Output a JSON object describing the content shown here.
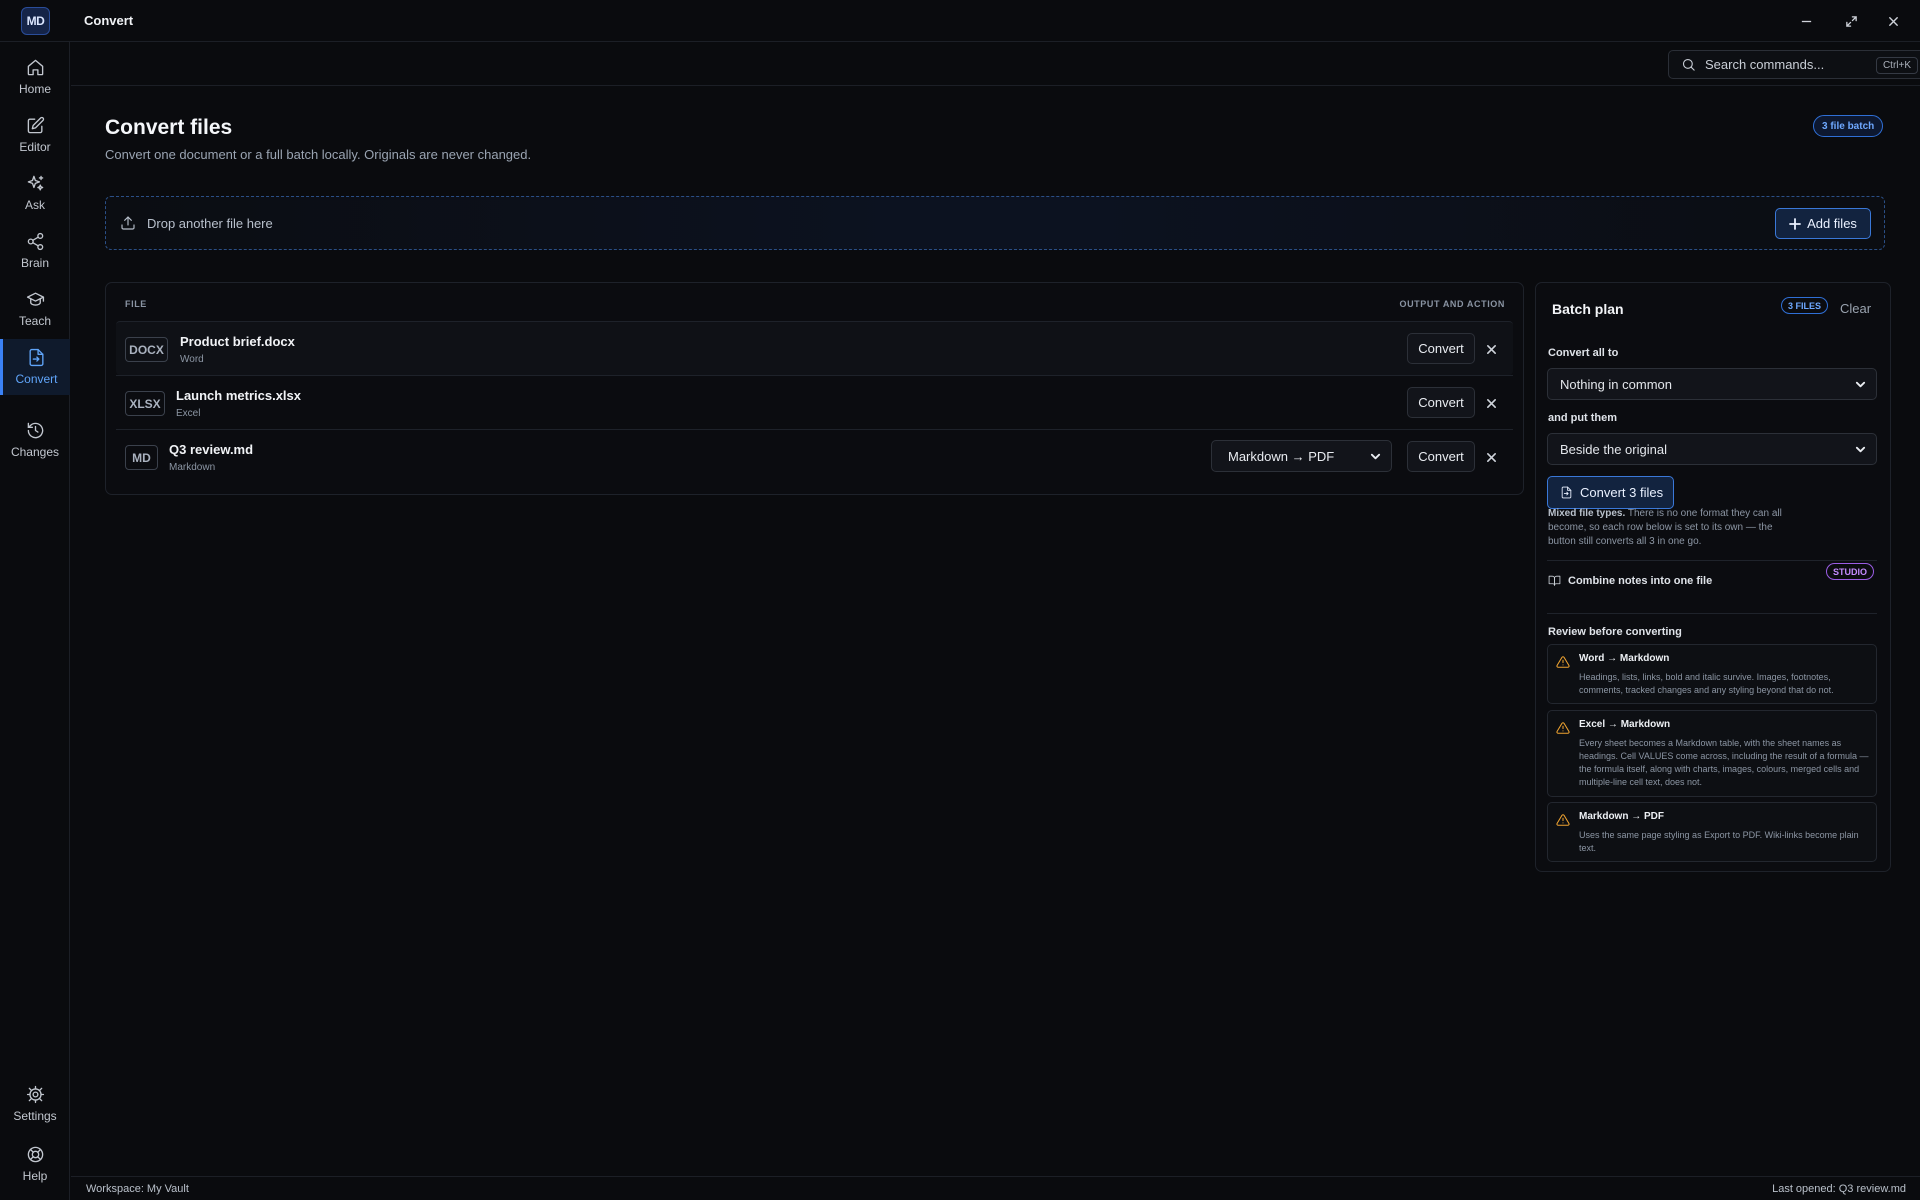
{
  "app": {
    "logo_text": "MD",
    "window_title": "Convert"
  },
  "sidebar": {
    "items": [
      {
        "label": "Home",
        "icon": "home-icon"
      },
      {
        "label": "Editor",
        "icon": "edit-icon"
      },
      {
        "label": "Ask",
        "icon": "sparkle-icon"
      },
      {
        "label": "Brain",
        "icon": "share-nodes-icon"
      },
      {
        "label": "Teach",
        "icon": "graduation-cap-icon"
      },
      {
        "label": "Convert",
        "icon": "file-convert-icon",
        "active": true
      },
      {
        "label": "Changes",
        "icon": "history-icon"
      }
    ],
    "bottom": [
      {
        "label": "Settings",
        "icon": "gear-icon"
      },
      {
        "label": "Help",
        "icon": "lifebuoy-icon"
      }
    ]
  },
  "search": {
    "placeholder": "Search commands...",
    "shortcut": "Ctrl+K"
  },
  "header": {
    "title": "Convert files",
    "subtitle": "Convert one document or a full batch locally. Originals are never changed.",
    "batch_badge": "3 file batch"
  },
  "dropzone": {
    "text": "Drop another file here",
    "add_button": "Add files"
  },
  "table": {
    "col_file": "FILE",
    "col_output": "OUTPUT AND ACTION",
    "rows": [
      {
        "badge": "DOCX",
        "name": "Product brief.docx",
        "type": "Word",
        "action": "Convert"
      },
      {
        "badge": "XLSX",
        "name": "Launch metrics.xlsx",
        "type": "Excel",
        "action": "Convert"
      },
      {
        "badge": "MD",
        "name": "Q3 review.md",
        "type": "Markdown",
        "action": "Convert",
        "select_value": "Markdown → PDF"
      }
    ]
  },
  "plan": {
    "title": "Batch plan",
    "files_badge": "3 FILES",
    "clear": "Clear",
    "convert_all_label": "Convert all to",
    "convert_all_value": "Nothing in common",
    "put_label": "and put them",
    "put_value": "Beside the original",
    "convert_button": "Convert 3 files",
    "mixed_title": "Mixed file types.",
    "mixed_body": "There is no one format they can all become, so each row below is set to its own — the button still converts all 3 in one go.",
    "combine_label": "Combine notes into one file",
    "studio_badge": "STUDIO",
    "review_heading": "Review before converting",
    "cards": [
      {
        "title": "Word → Markdown",
        "body": "Headings, lists, links, bold and italic survive. Images, footnotes, comments, tracked changes and any styling beyond that do not."
      },
      {
        "title": "Excel → Markdown",
        "body": "Every sheet becomes a Markdown table, with the sheet names as headings. Cell VALUES come across, including the result of a formula — the formula itself, along with charts, images, colours, merged cells and multiple-line cell text, does not."
      },
      {
        "title": "Markdown → PDF",
        "body": "Uses the same page styling as Export to PDF. Wiki-links become plain text."
      }
    ]
  },
  "status": {
    "workspace": "Workspace: My Vault",
    "last_opened": "Last opened: Q3 review.md"
  },
  "colors": {
    "accent": "#3b82f6",
    "warning": "#f0a431",
    "studio": "#9b5de5",
    "background": "#0a0b0e"
  }
}
